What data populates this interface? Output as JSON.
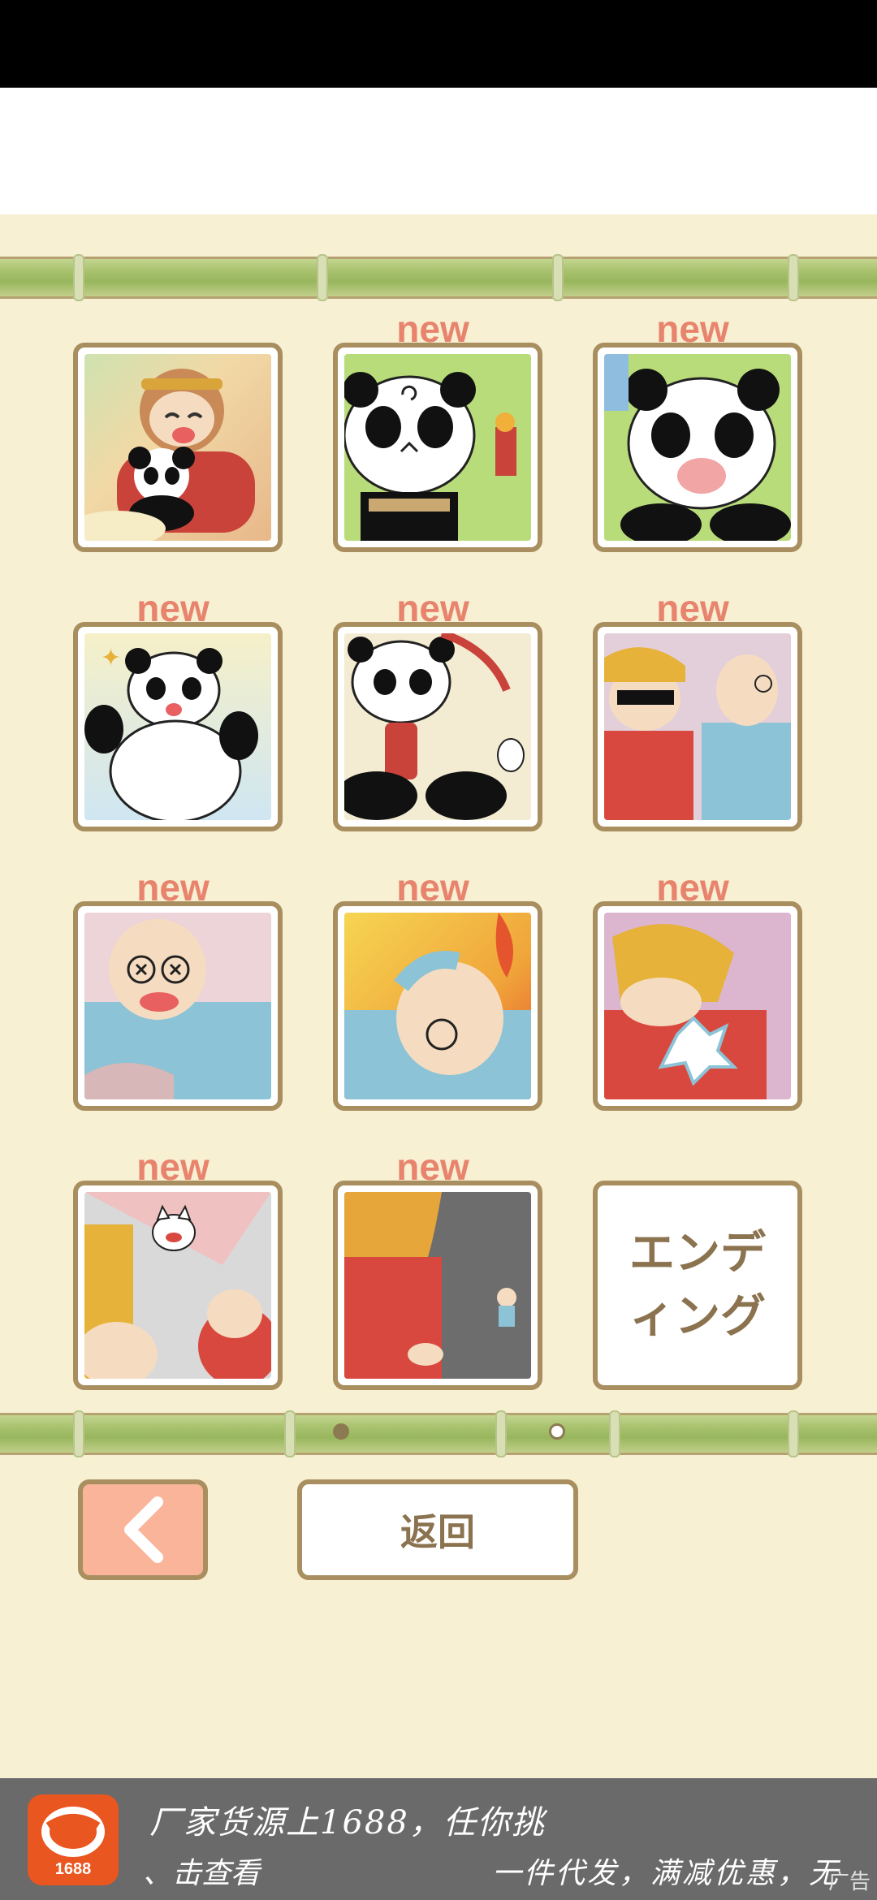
{
  "new_label": "new",
  "tiles": [
    {
      "name": "tile-monkey-king-panda",
      "is_new": false
    },
    {
      "name": "tile-dizzy-panda",
      "is_new": true
    },
    {
      "name": "tile-crying-panda",
      "is_new": true
    },
    {
      "name": "tile-happy-panda",
      "is_new": true
    },
    {
      "name": "tile-panda-barrel",
      "is_new": true
    },
    {
      "name": "tile-workers",
      "is_new": true
    },
    {
      "name": "tile-knocked-out-old-man",
      "is_new": true
    },
    {
      "name": "tile-burning-old-man",
      "is_new": true
    },
    {
      "name": "tile-hit-worker",
      "is_new": true
    },
    {
      "name": "tile-angry-cat",
      "is_new": true
    },
    {
      "name": "tile-looking-down",
      "is_new": true
    }
  ],
  "ending_tile": {
    "label": "エンディング"
  },
  "pagination": {
    "current_page": 2,
    "total_pages": 2
  },
  "buttons": {
    "return_label": "返回"
  },
  "colors": {
    "accent_new": "#e8846e",
    "frame": "#a98f60",
    "background": "#f7f0d3",
    "back_button": "#f9b49a"
  },
  "ad": {
    "logo_text": "1688",
    "title": "厂家货源上1688，任你挑",
    "subtitle_left": "、击查看",
    "subtitle_right": "一件代发，满减优惠，无",
    "tag": "广告"
  }
}
